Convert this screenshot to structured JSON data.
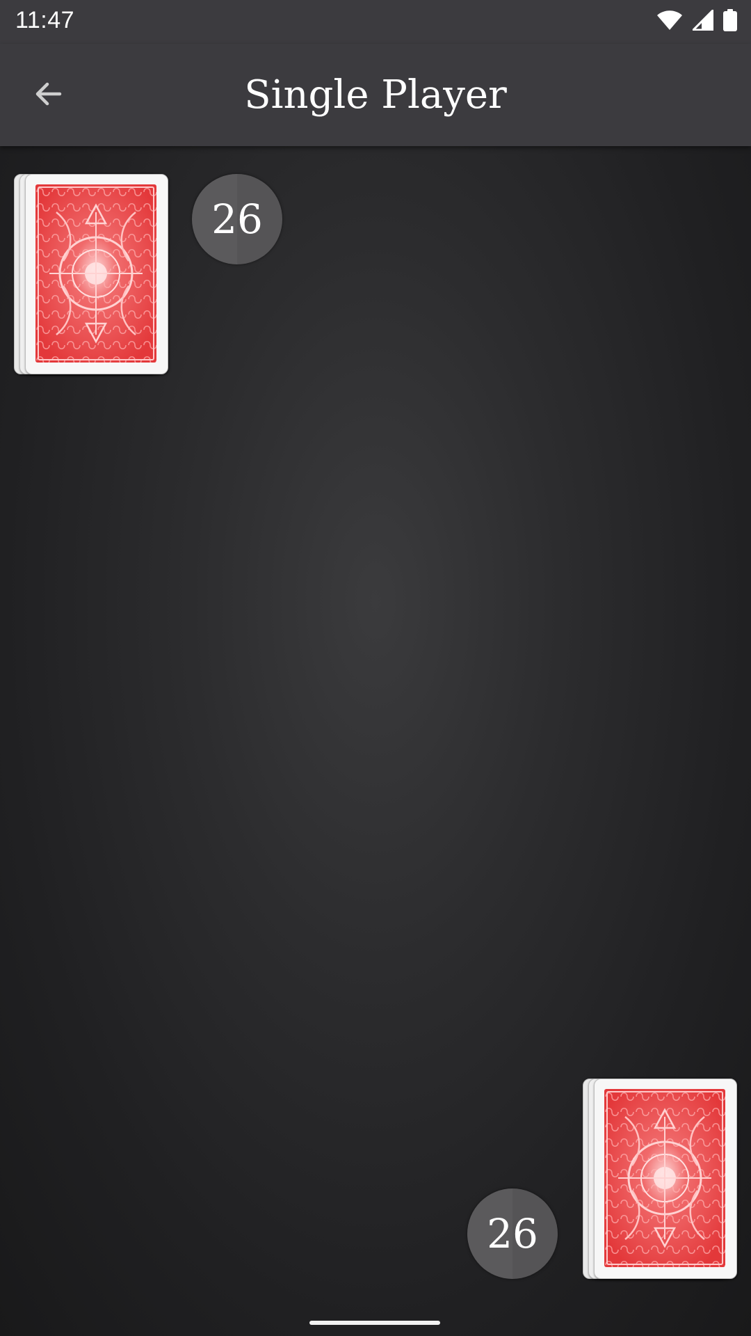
{
  "status_bar": {
    "time": "11:47",
    "icons": [
      "wifi-icon",
      "cell-signal-icon",
      "battery-icon"
    ]
  },
  "app_bar": {
    "title": "Single Player",
    "back_icon": "arrow-left-icon"
  },
  "game": {
    "opponent": {
      "card_count": "26"
    },
    "player": {
      "card_count": "26"
    }
  },
  "colors": {
    "bar_background": "#3c3b3f",
    "table_background": "#2a2a2c",
    "card_back_red": "#e8383b",
    "badge_background": "#5a595b"
  }
}
